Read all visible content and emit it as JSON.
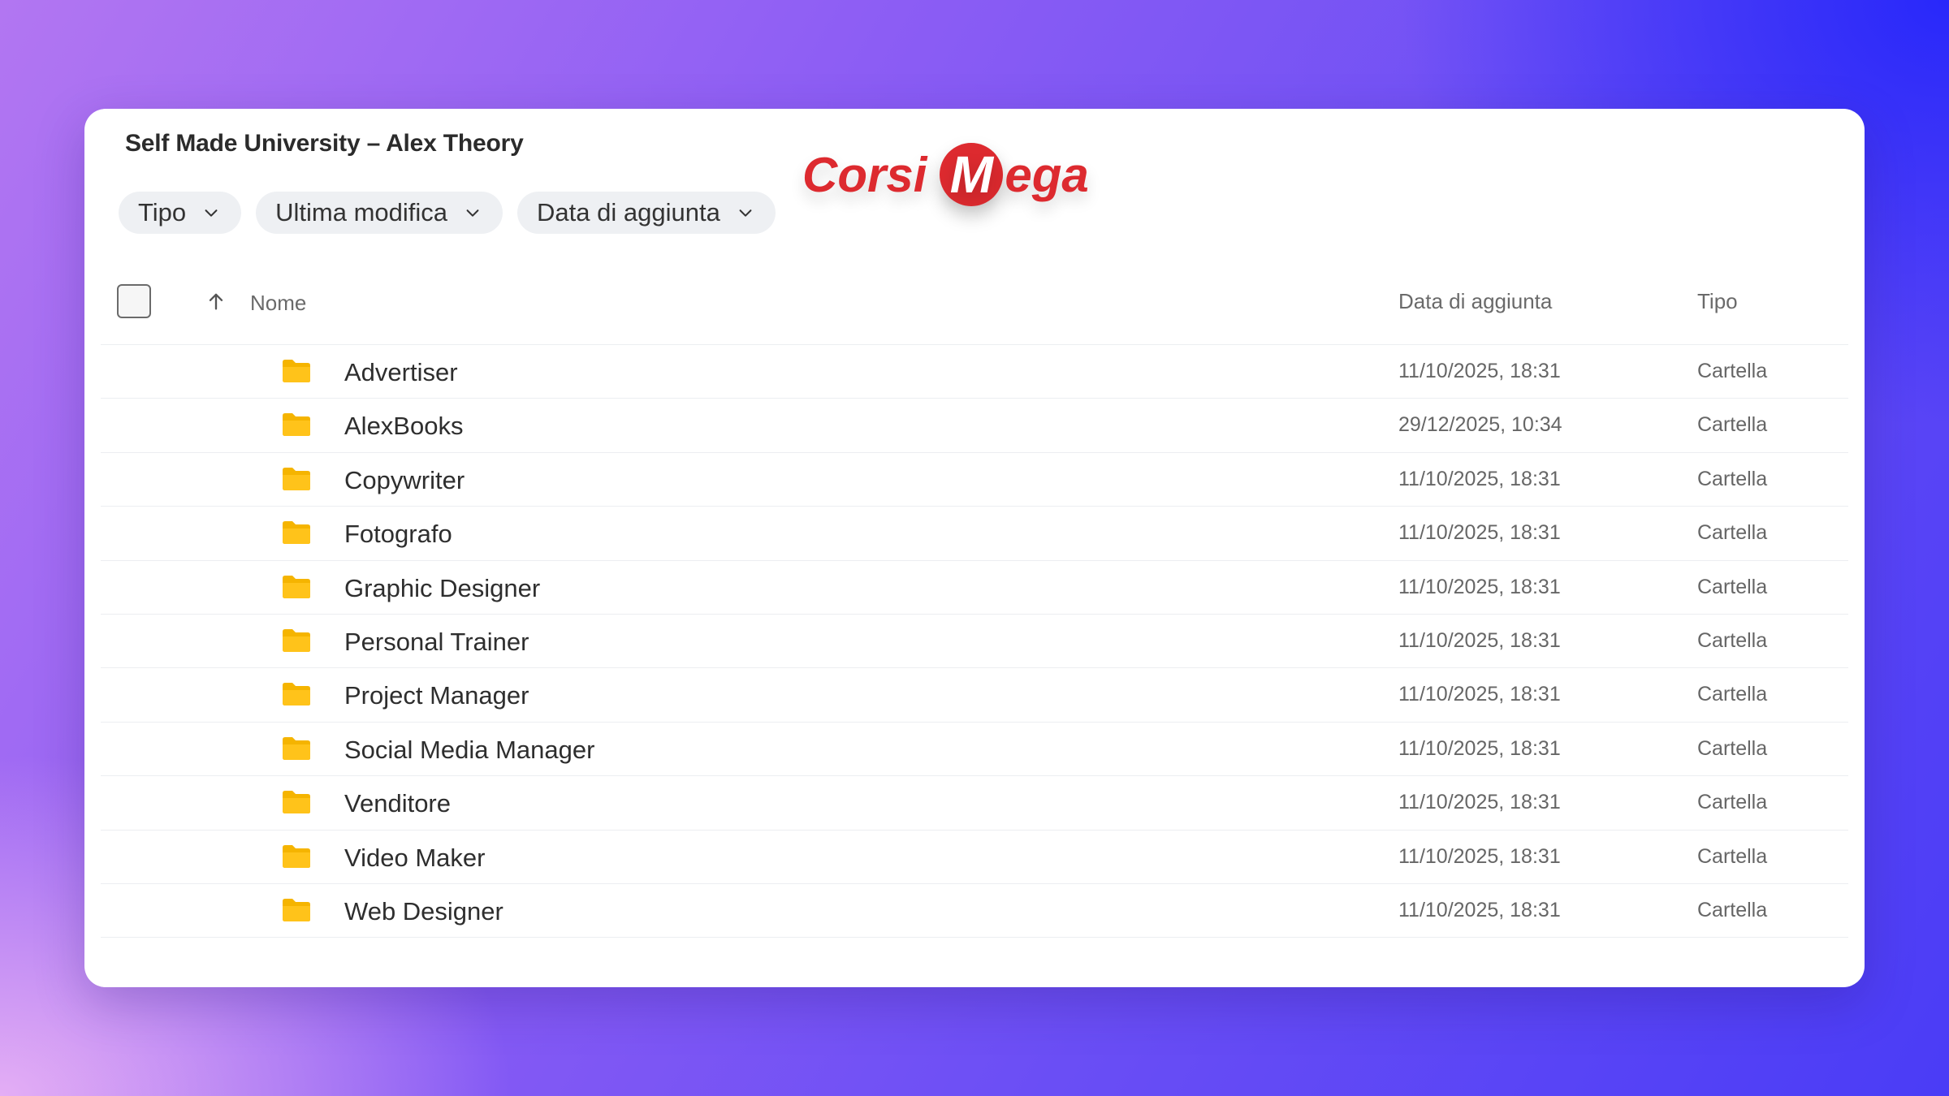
{
  "window": {
    "title": "Self Made University – Alex Theory"
  },
  "logo": {
    "part1": "Corsi",
    "m": "M",
    "part2": "ega",
    "color": "#dd2a2f"
  },
  "filters": [
    {
      "label": "Tipo"
    },
    {
      "label": "Ultima modifica"
    },
    {
      "label": "Data di aggiunta"
    }
  ],
  "table": {
    "columns": {
      "name": "Nome",
      "date": "Data di aggiunta",
      "type": "Tipo"
    },
    "rows": [
      {
        "name": "Advertiser",
        "date": "11/10/2025, 18:31",
        "type": "Cartella"
      },
      {
        "name": "AlexBooks",
        "date": "29/12/2025, 10:34",
        "type": "Cartella"
      },
      {
        "name": "Copywriter",
        "date": "11/10/2025, 18:31",
        "type": "Cartella"
      },
      {
        "name": "Fotografo",
        "date": "11/10/2025, 18:31",
        "type": "Cartella"
      },
      {
        "name": "Graphic Designer",
        "date": "11/10/2025, 18:31",
        "type": "Cartella"
      },
      {
        "name": "Personal Trainer",
        "date": "11/10/2025, 18:31",
        "type": "Cartella"
      },
      {
        "name": "Project Manager",
        "date": "11/10/2025, 18:31",
        "type": "Cartella"
      },
      {
        "name": "Social Media Manager",
        "date": "11/10/2025, 18:31",
        "type": "Cartella"
      },
      {
        "name": "Venditore",
        "date": "11/10/2025, 18:31",
        "type": "Cartella"
      },
      {
        "name": "Video Maker",
        "date": "11/10/2025, 18:31",
        "type": "Cartella"
      },
      {
        "name": "Web Designer",
        "date": "11/10/2025, 18:31",
        "type": "Cartella"
      }
    ]
  },
  "icons": {
    "folder": "folder-icon",
    "chevron": "chevron-down-icon",
    "sort": "arrow-up-icon"
  },
  "colors": {
    "folder": "#f5b400",
    "accent": "#dd2a2f"
  }
}
